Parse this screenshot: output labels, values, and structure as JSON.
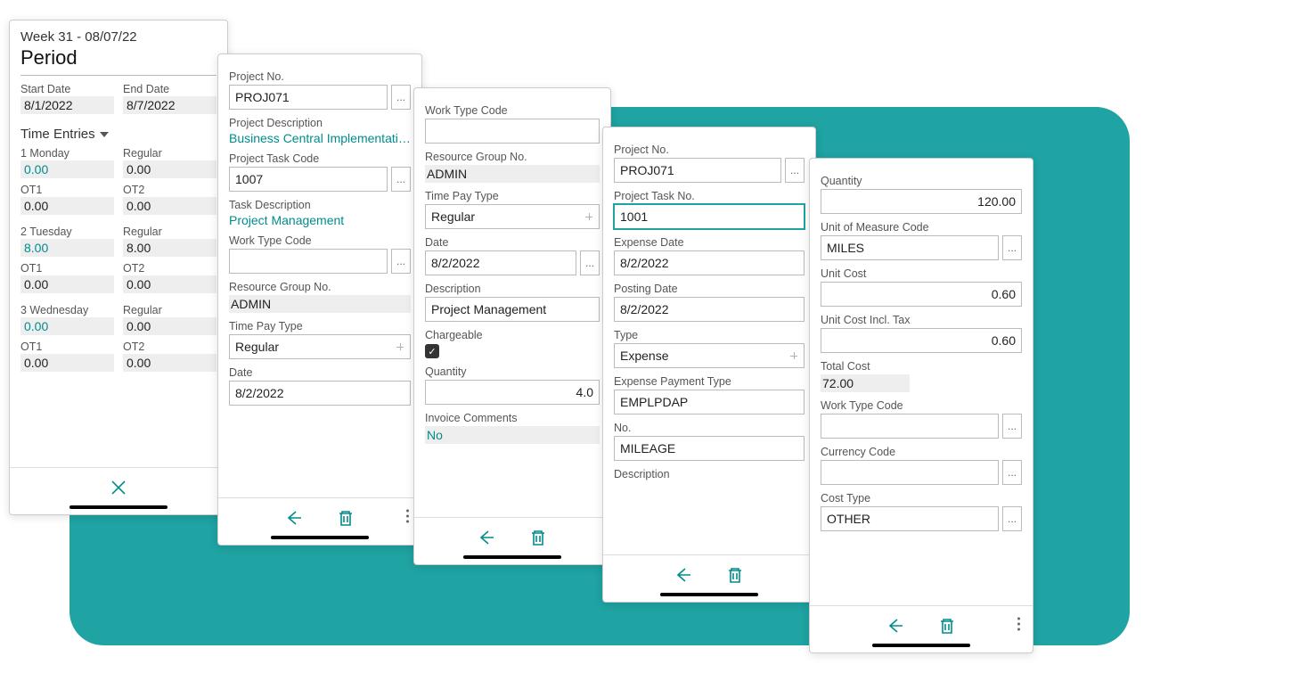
{
  "panel1": {
    "week_title": "Week 31 - 08/07/22",
    "period_label": "Period",
    "start_date_label": "Start Date",
    "start_date": "8/1/2022",
    "end_date_label": "End Date",
    "end_date": "8/7/2022",
    "entries_label": "Time Entries",
    "rows": [
      {
        "day_label": "1 Monday",
        "day_val": "0.00",
        "reg_label": "Regular",
        "reg_val": "0.00",
        "ot1_label": "OT1",
        "ot1_val": "0.00",
        "ot2_label": "OT2",
        "ot2_val": "0.00"
      },
      {
        "day_label": "2 Tuesday",
        "day_val": "8.00",
        "reg_label": "Regular",
        "reg_val": "8.00",
        "ot1_label": "OT1",
        "ot1_val": "0.00",
        "ot2_label": "OT2",
        "ot2_val": "0.00"
      },
      {
        "day_label": "3 Wednesday",
        "day_val": "0.00",
        "reg_label": "Regular",
        "reg_val": "0.00",
        "ot1_label": "OT1",
        "ot1_val": "0.00",
        "ot2_label": "OT2",
        "ot2_val": "0.00"
      }
    ]
  },
  "panel2": {
    "project_no_label": "Project No.",
    "project_no": "PROJ071",
    "project_desc_label": "Project Description",
    "project_desc": "Business Central Implementation.",
    "task_code_label": "Project Task Code",
    "task_code": "1007",
    "task_desc_label": "Task Description",
    "task_desc": "Project Management",
    "work_type_label": "Work Type Code",
    "work_type": "",
    "res_group_label": "Resource Group No.",
    "res_group": "ADMIN",
    "time_pay_label": "Time Pay Type",
    "time_pay": "Regular",
    "date_label": "Date",
    "date": "8/2/2022"
  },
  "panel3": {
    "work_type_label": "Work Type Code",
    "work_type": "",
    "res_group_label": "Resource Group No.",
    "res_group": "ADMIN",
    "time_pay_label": "Time Pay Type",
    "time_pay": "Regular",
    "date_label": "Date",
    "date": "8/2/2022",
    "desc_label": "Description",
    "desc": "Project Management",
    "chargeable_label": "Chargeable",
    "quantity_label": "Quantity",
    "quantity": "4.0",
    "comments_label": "Invoice Comments",
    "comments": "No"
  },
  "panel4": {
    "project_no_label": "Project No.",
    "project_no": "PROJ071",
    "task_no_label": "Project Task No.",
    "task_no": "1001",
    "exp_date_label": "Expense Date",
    "exp_date": "8/2/2022",
    "post_date_label": "Posting Date",
    "post_date": "8/2/2022",
    "type_label": "Type",
    "type": "Expense",
    "pay_type_label": "Expense Payment Type",
    "pay_type": "EMPLPDAP",
    "no_label": "No.",
    "no": "MILEAGE",
    "desc_label": "Description"
  },
  "panel5": {
    "qty_label": "Quantity",
    "qty": "120.00",
    "uom_label": "Unit of Measure Code",
    "uom": "MILES",
    "unit_cost_label": "Unit Cost",
    "unit_cost": "0.60",
    "unit_cost_tax_label": "Unit Cost Incl. Tax",
    "unit_cost_tax": "0.60",
    "total_label": "Total Cost",
    "total": "72.00",
    "work_type_label": "Work Type Code",
    "work_type": "",
    "currency_label": "Currency Code",
    "currency": "",
    "cost_type_label": "Cost Type",
    "cost_type": "OTHER"
  },
  "ellipsis": "..."
}
